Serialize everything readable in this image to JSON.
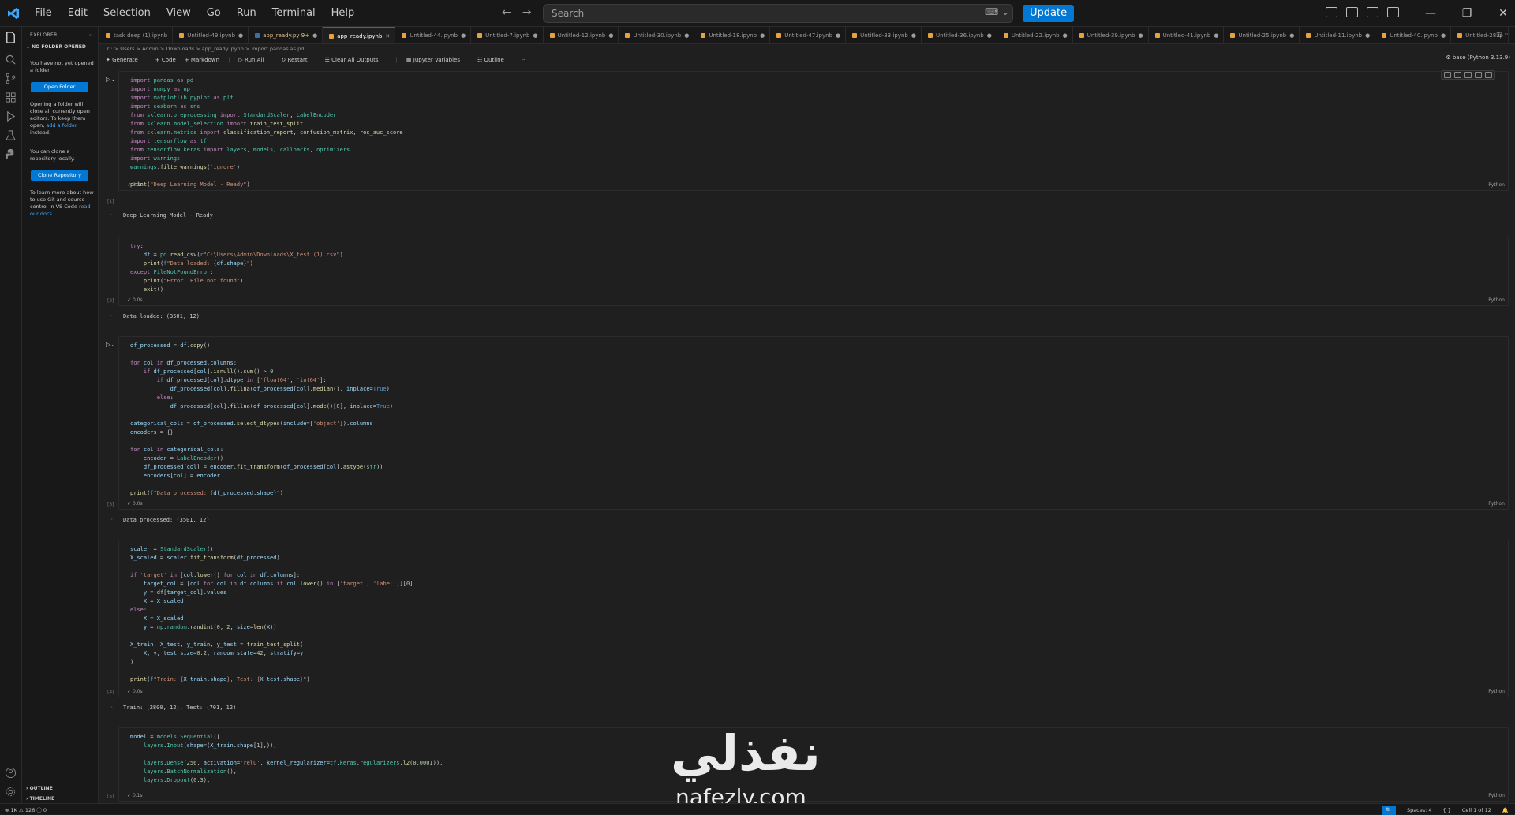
{
  "titlebar": {
    "menu": [
      "File",
      "Edit",
      "Selection",
      "View",
      "Go",
      "Run",
      "Terminal",
      "Help"
    ],
    "search_placeholder": "Search",
    "update_label": "Update"
  },
  "sidebar": {
    "header": "EXPLORER",
    "section": "NO FOLDER OPENED",
    "msg1": "You have not yet opened a folder.",
    "open_folder": "Open Folder",
    "msg2a": "Opening a folder will close all currently open editors. To keep them open,",
    "msg2link": "add a folder",
    "msg2b": "instead.",
    "msg3": "You can clone a repository locally.",
    "clone": "Clone Repository",
    "msg4a": "To learn more about how to use Git and source control in VS Code",
    "msg4link": "read our docs",
    "outline": "OUTLINE",
    "timeline": "TIMELINE"
  },
  "tabs": [
    {
      "label": "task deep (1).ipynb",
      "active": false,
      "mod": false
    },
    {
      "label": "Untitled-49.ipynb",
      "active": false,
      "mod": false
    },
    {
      "label": "app_ready.py 9+",
      "active": false,
      "mod": true
    },
    {
      "label": "app_ready.ipynb",
      "active": true,
      "mod": false
    },
    {
      "label": "Untitled-44.ipynb",
      "active": false,
      "mod": false
    },
    {
      "label": "Untitled-7.ipynb",
      "active": false,
      "mod": false
    },
    {
      "label": "Untitled-12.ipynb",
      "active": false,
      "mod": false
    },
    {
      "label": "Untitled-30.ipynb",
      "active": false,
      "mod": false
    },
    {
      "label": "Untitled-18.ipynb",
      "active": false,
      "mod": false
    },
    {
      "label": "Untitled-47.ipynb",
      "active": false,
      "mod": false
    },
    {
      "label": "Untitled-33.ipynb",
      "active": false,
      "mod": false
    },
    {
      "label": "Untitled-36.ipynb",
      "active": false,
      "mod": false
    },
    {
      "label": "Untitled-22.ipynb",
      "active": false,
      "mod": false
    },
    {
      "label": "Untitled-39.ipynb",
      "active": false,
      "mod": false
    },
    {
      "label": "Untitled-41.ipynb",
      "active": false,
      "mod": false
    },
    {
      "label": "Untitled-25.ipynb",
      "active": false,
      "mod": false
    },
    {
      "label": "Untitled-11.ipynb",
      "active": false,
      "mod": false
    },
    {
      "label": "Untitled-40.ipynb",
      "active": false,
      "mod": false
    },
    {
      "label": "Untitled-28.ip",
      "active": false,
      "mod": false
    }
  ],
  "breadcrumb": "C: > Users > Admin > Downloads > app_ready.ipynb > import pandas as pd",
  "toolbar": {
    "generate": "Generate",
    "code": "+ Code",
    "markdown": "+ Markdown",
    "run_all": "Run All",
    "restart": "Restart",
    "clear": "Clear All Outputs",
    "vars": "Jupyter Variables",
    "outline": "Outline"
  },
  "kernel": "base (Python 3.13.9)",
  "cells": [
    {
      "count": "[1]",
      "time": "6.3s",
      "lang": "Python",
      "output": "Deep Learning Model - Ready"
    },
    {
      "count": "[2]",
      "time": "0.0s",
      "lang": "Python",
      "output": "Data loaded: (3501, 12)"
    },
    {
      "count": "[3]",
      "time": "0.0s",
      "lang": "Python",
      "output": "Data processed: (3501, 12)"
    },
    {
      "count": "[4]",
      "time": "0.0s",
      "lang": "Python",
      "output": "Train: (2800, 12), Test: (701, 12)"
    },
    {
      "count": "[5]",
      "time": "0.1s",
      "lang": "Python",
      "output": ""
    }
  ],
  "statusbar": {
    "left": "⊗ 1K  ⚠ 126  ⓘ 0",
    "spaces": "Spaces: 4",
    "braces": "{ }",
    "cell": "Cell 1 of 12"
  },
  "watermark": {
    "arabic": "نفذلي",
    "latin": "nafezly.com"
  }
}
